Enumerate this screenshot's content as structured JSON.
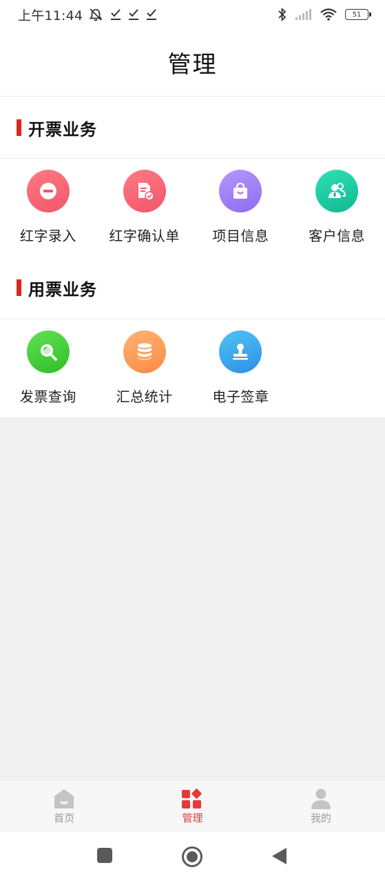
{
  "status_bar": {
    "time": "上午11:44",
    "battery": "51"
  },
  "title": "管理",
  "sections": [
    {
      "title": "开票业务",
      "items": [
        {
          "label": "红字录入",
          "icon": "minus-circle-icon",
          "color": "#f65f6e"
        },
        {
          "label": "红字确认单",
          "icon": "document-check-icon",
          "color": "#f65f6e"
        },
        {
          "label": "项目信息",
          "icon": "shopping-bag-icon",
          "color": "#9b7cf3"
        },
        {
          "label": "客户信息",
          "icon": "users-icon",
          "color": "#1ec9a4"
        }
      ]
    },
    {
      "title": "用票业务",
      "items": [
        {
          "label": "发票查询",
          "icon": "search-icon",
          "color": "#3fcf3a"
        },
        {
          "label": "汇总统计",
          "icon": "database-icon",
          "color": "#ff9a56"
        },
        {
          "label": "电子签章",
          "icon": "stamp-icon",
          "color": "#3aa8ee"
        }
      ]
    }
  ],
  "bottom_nav": [
    {
      "label": "首页",
      "icon": "home-icon",
      "active": false
    },
    {
      "label": "管理",
      "icon": "apps-icon",
      "active": true
    },
    {
      "label": "我的",
      "icon": "user-icon",
      "active": false
    }
  ],
  "colors": {
    "accent": "#d9261c",
    "active_nav": "#e23b3b",
    "inactive_nav": "#c4c4c4"
  }
}
